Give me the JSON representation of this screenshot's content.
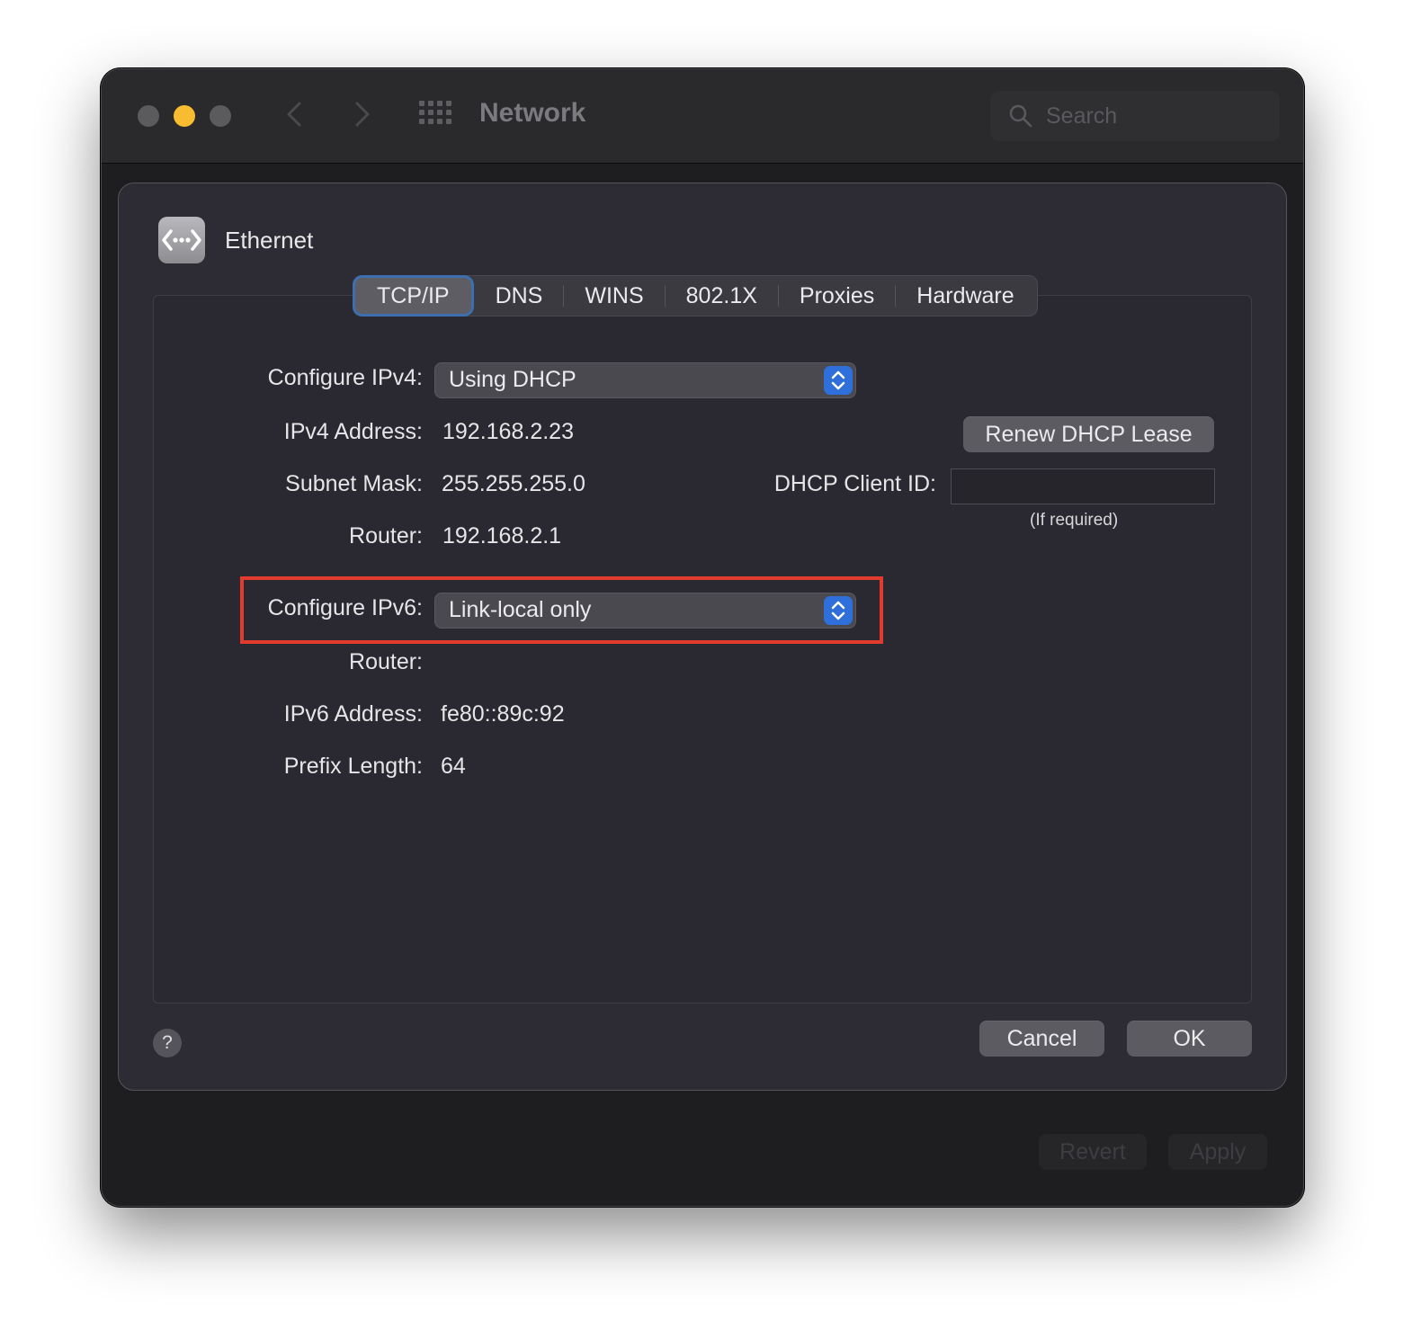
{
  "window": {
    "title": "Network",
    "search_placeholder": "Search"
  },
  "sheet": {
    "interface_name": "Ethernet",
    "tabs": [
      {
        "label": "TCP/IP",
        "active": true
      },
      {
        "label": "DNS"
      },
      {
        "label": "WINS"
      },
      {
        "label": "802.1X"
      },
      {
        "label": "Proxies"
      },
      {
        "label": "Hardware"
      }
    ],
    "ipv4": {
      "configure_label": "Configure IPv4:",
      "configure_value": "Using DHCP",
      "address_label": "IPv4 Address:",
      "address_value": "192.168.2.23",
      "subnet_label": "Subnet Mask:",
      "subnet_value": "255.255.255.0",
      "router_label": "Router:",
      "router_value": "192.168.2.1",
      "renew_button": "Renew DHCP Lease",
      "client_id_label": "DHCP Client ID:",
      "client_id_value": "",
      "client_id_hint": "(If required)"
    },
    "ipv6": {
      "configure_label": "Configure IPv6:",
      "configure_value": "Link-local only",
      "router_label": "Router:",
      "router_value": "",
      "address_label": "IPv6 Address:",
      "address_value": "fe80::89c:92",
      "prefix_label": "Prefix Length:",
      "prefix_value": "64"
    },
    "help_label": "?",
    "cancel_button": "Cancel",
    "ok_button": "OK"
  },
  "footer": {
    "revert_button": "Revert",
    "apply_button": "Apply"
  },
  "colors": {
    "highlight": "#e03b2c",
    "accent": "#2f6fdc"
  }
}
